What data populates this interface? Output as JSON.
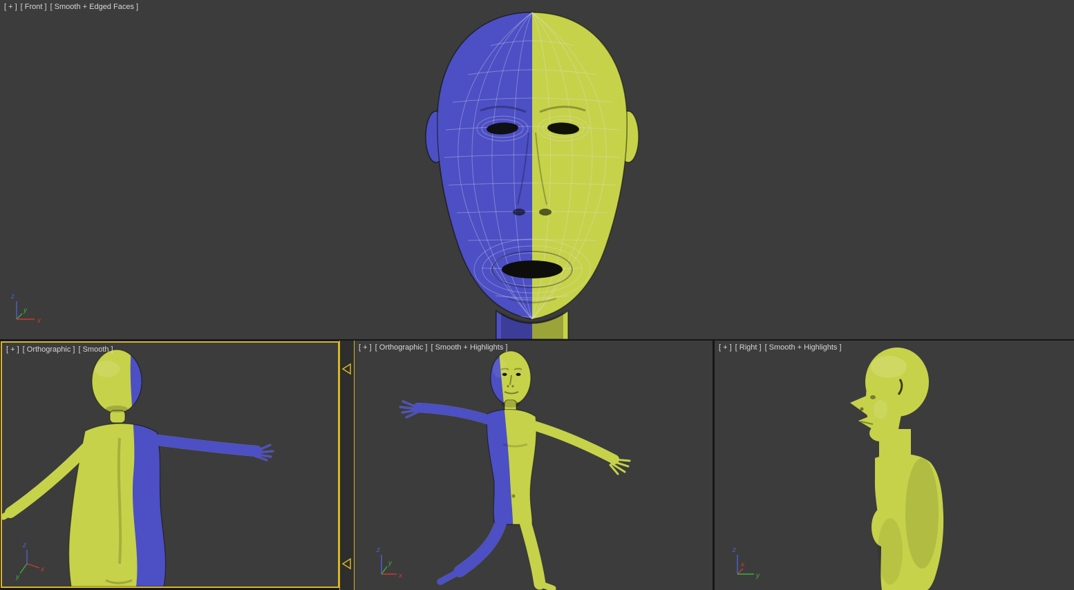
{
  "viewports": [
    {
      "id": "front",
      "plus": "[ + ]",
      "view": "[ Front ]",
      "shading": "[ Smooth + Edged Faces ]"
    },
    {
      "id": "ortho-a",
      "plus": "[ + ]",
      "view": "[ Orthographic ]",
      "shading": "[ Smooth ]"
    },
    {
      "id": "ortho-b",
      "plus": "[ + ]",
      "view": "[ Orthographic ]",
      "shading": "[ Smooth + Highlights ]"
    },
    {
      "id": "right",
      "plus": "[ + ]",
      "view": "[ Right ]",
      "shading": "[ Smooth + Highlights ]"
    }
  ],
  "axis_labels": {
    "x": "x",
    "y": "y",
    "z": "z"
  },
  "colors": {
    "viewport_bg": "#3c3c3c",
    "divider": "#171717",
    "splitter_bg": "#2e2e2e",
    "label_text": "#d6d6d6",
    "active_border": "#d9b822",
    "model_blue": "#4d4fc4",
    "model_yellow": "#c6d24a",
    "wireframe": "rgba(225,232,238,0.34)",
    "feature_dark": "#101208",
    "axis_x": "#d03a2a",
    "axis_y": "#3fae3f",
    "axis_z": "#4b61d6"
  }
}
